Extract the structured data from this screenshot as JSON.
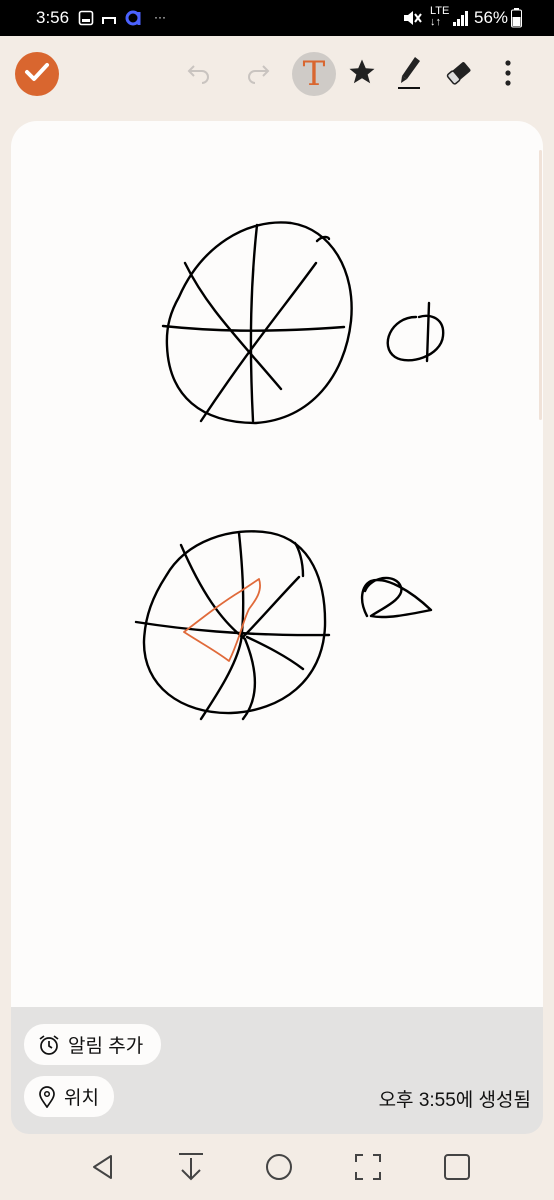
{
  "status_bar": {
    "time": "3:56",
    "network": "LTE",
    "battery": "56%",
    "icons": [
      "sim-card-icon",
      "cast-icon",
      "app-notification-icon",
      "more-notifications-icon",
      "mute-icon",
      "lte-icon",
      "signal-icon",
      "battery-icon"
    ]
  },
  "toolbar": {
    "text_tool_glyph": "T",
    "buttons": [
      "done",
      "undo",
      "redo",
      "text",
      "favorite",
      "pen",
      "eraser",
      "more"
    ],
    "accent_color": "#d9662f"
  },
  "drawing": {
    "stroke_color": "#000000",
    "highlight_color": "#e06a3a"
  },
  "info": {
    "alarm_label": "알림 추가",
    "location_label": "위치",
    "created_label": "오후 3:55에 생성됨"
  },
  "nav": {
    "buttons": [
      "back",
      "hide-keyboard",
      "home",
      "screenshot",
      "recents"
    ]
  }
}
